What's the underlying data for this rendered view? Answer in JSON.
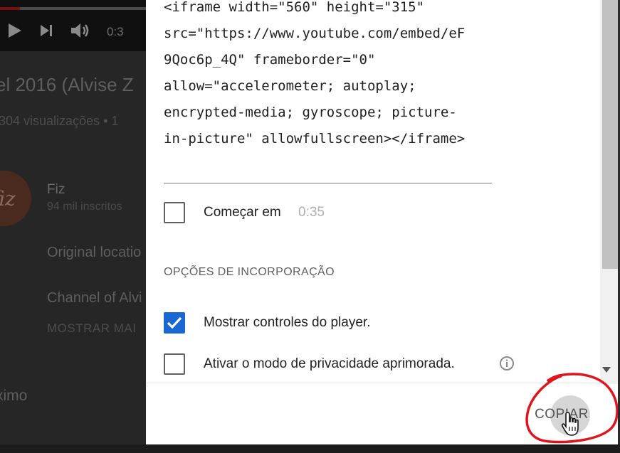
{
  "background": {
    "player": {
      "time_label": "0:3"
    },
    "video_title": "el 2016 (Alvise Z",
    "views": "304 visualizações • 1",
    "channel": {
      "avatar_text": "fiz",
      "name": "Fiz",
      "subscribers": "94 mil inscritos"
    },
    "description_lines": [
      "Original locatio",
      "Channel of Alvi"
    ],
    "show_more": "MOSTRAR MAI",
    "next_label": "ximo"
  },
  "dialog": {
    "embed_code": "<iframe width=\"560\" height=\"315\"\nsrc=\"https://www.youtube.com/embed/eF\n9Qoc6p_4Q\" frameborder=\"0\"\nallow=\"accelerometer; autoplay;\nencrypted-media; gyroscope; picture-\nin-picture\" allowfullscreen></iframe>",
    "start_at": {
      "label": "Começar em",
      "time": "0:35",
      "checked": false
    },
    "section_title": "OPÇÕES DE INCORPORAÇÃO",
    "options": [
      {
        "label": "Mostrar controles do player.",
        "checked": true
      },
      {
        "label": "Ativar o modo de privacidade aprimorada.",
        "checked": false
      }
    ],
    "copy_button": "COPIAR"
  },
  "colors": {
    "checkbox_accent": "#1a66d2",
    "annotation_red": "#e0141c",
    "progress_red": "#7a1010"
  },
  "icons": {
    "play": "play-icon",
    "next": "skip-next-icon",
    "volume": "volume-icon",
    "info": "info-icon",
    "check": "checkmark-icon",
    "cursor": "hand-cursor-icon"
  }
}
